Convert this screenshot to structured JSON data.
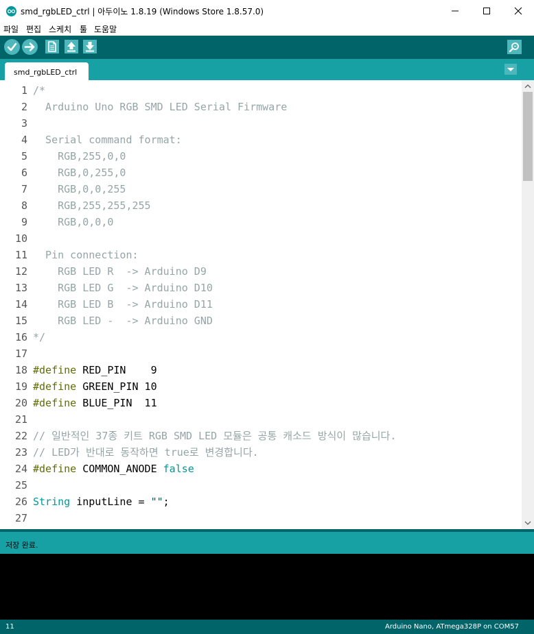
{
  "window": {
    "title": "smd_rgbLED_ctrl | 아두이노 1.8.19 (Windows Store 1.8.57.0)"
  },
  "menu": [
    "파일",
    "편집",
    "스케치",
    "툴",
    "도움말"
  ],
  "toolbar": {
    "buttons": [
      "verify-icon",
      "upload-icon",
      "new-icon",
      "open-icon",
      "save-icon"
    ],
    "serial_monitor": "serial-monitor-icon"
  },
  "tabs": [
    {
      "label": "smd_rgbLED_ctrl"
    }
  ],
  "editor": {
    "lines": [
      {
        "n": "1",
        "spans": [
          {
            "t": "/*",
            "c": "c-comment"
          }
        ]
      },
      {
        "n": "2",
        "spans": [
          {
            "t": "  Arduino Uno RGB SMD LED Serial Firmware",
            "c": "c-comment"
          }
        ]
      },
      {
        "n": "3",
        "spans": []
      },
      {
        "n": "4",
        "spans": [
          {
            "t": "  Serial command format:",
            "c": "c-comment"
          }
        ]
      },
      {
        "n": "5",
        "spans": [
          {
            "t": "    RGB,255,0,0",
            "c": "c-comment"
          }
        ]
      },
      {
        "n": "6",
        "spans": [
          {
            "t": "    RGB,0,255,0",
            "c": "c-comment"
          }
        ]
      },
      {
        "n": "7",
        "spans": [
          {
            "t": "    RGB,0,0,255",
            "c": "c-comment"
          }
        ]
      },
      {
        "n": "8",
        "spans": [
          {
            "t": "    RGB,255,255,255",
            "c": "c-comment"
          }
        ]
      },
      {
        "n": "9",
        "spans": [
          {
            "t": "    RGB,0,0,0",
            "c": "c-comment"
          }
        ]
      },
      {
        "n": "10",
        "spans": []
      },
      {
        "n": "11",
        "spans": [
          {
            "t": "  Pin connection:",
            "c": "c-comment"
          }
        ]
      },
      {
        "n": "12",
        "spans": [
          {
            "t": "    RGB LED R  -> Arduino D9",
            "c": "c-comment"
          }
        ]
      },
      {
        "n": "13",
        "spans": [
          {
            "t": "    RGB LED G  -> Arduino D10",
            "c": "c-comment"
          }
        ]
      },
      {
        "n": "14",
        "spans": [
          {
            "t": "    RGB LED B  -> Arduino D11",
            "c": "c-comment"
          }
        ]
      },
      {
        "n": "15",
        "spans": [
          {
            "t": "    RGB LED -  -> Arduino GND",
            "c": "c-comment"
          }
        ]
      },
      {
        "n": "16",
        "spans": [
          {
            "t": "*/",
            "c": "c-comment"
          }
        ]
      },
      {
        "n": "17",
        "spans": []
      },
      {
        "n": "18",
        "spans": [
          {
            "t": "#define",
            "c": "c-kw"
          },
          {
            "t": " RED_PIN    9",
            "c": ""
          }
        ]
      },
      {
        "n": "19",
        "spans": [
          {
            "t": "#define",
            "c": "c-kw"
          },
          {
            "t": " GREEN_PIN 10",
            "c": ""
          }
        ]
      },
      {
        "n": "20",
        "spans": [
          {
            "t": "#define",
            "c": "c-kw"
          },
          {
            "t": " BLUE_PIN  11",
            "c": ""
          }
        ]
      },
      {
        "n": "21",
        "spans": []
      },
      {
        "n": "22",
        "spans": [
          {
            "t": "// 일반적인 37종 키트 RGB SMD LED 모듈은 공통 캐소드 방식이 많습니다.",
            "c": "c-comment"
          }
        ]
      },
      {
        "n": "23",
        "spans": [
          {
            "t": "// LED가 반대로 동작하면 true로 변경합니다.",
            "c": "c-comment"
          }
        ]
      },
      {
        "n": "24",
        "spans": [
          {
            "t": "#define",
            "c": "c-kw"
          },
          {
            "t": " COMMON_ANODE ",
            "c": ""
          },
          {
            "t": "false",
            "c": "c-lit"
          }
        ]
      },
      {
        "n": "25",
        "spans": []
      },
      {
        "n": "26",
        "spans": [
          {
            "t": "String",
            "c": "c-type"
          },
          {
            "t": " inputLine = ",
            "c": ""
          },
          {
            "t": "\"\"",
            "c": "c-str"
          },
          {
            "t": ";",
            "c": ""
          }
        ]
      },
      {
        "n": "27",
        "spans": []
      }
    ]
  },
  "status": {
    "message": "저장 완료."
  },
  "footer": {
    "line_number": "11",
    "board": "Arduino Nano, ATmega328P on COM57"
  },
  "colors": {
    "toolbar": "#006468",
    "tabstrip": "#17a1a5",
    "button": "#4db7bb",
    "console": "#000000"
  }
}
